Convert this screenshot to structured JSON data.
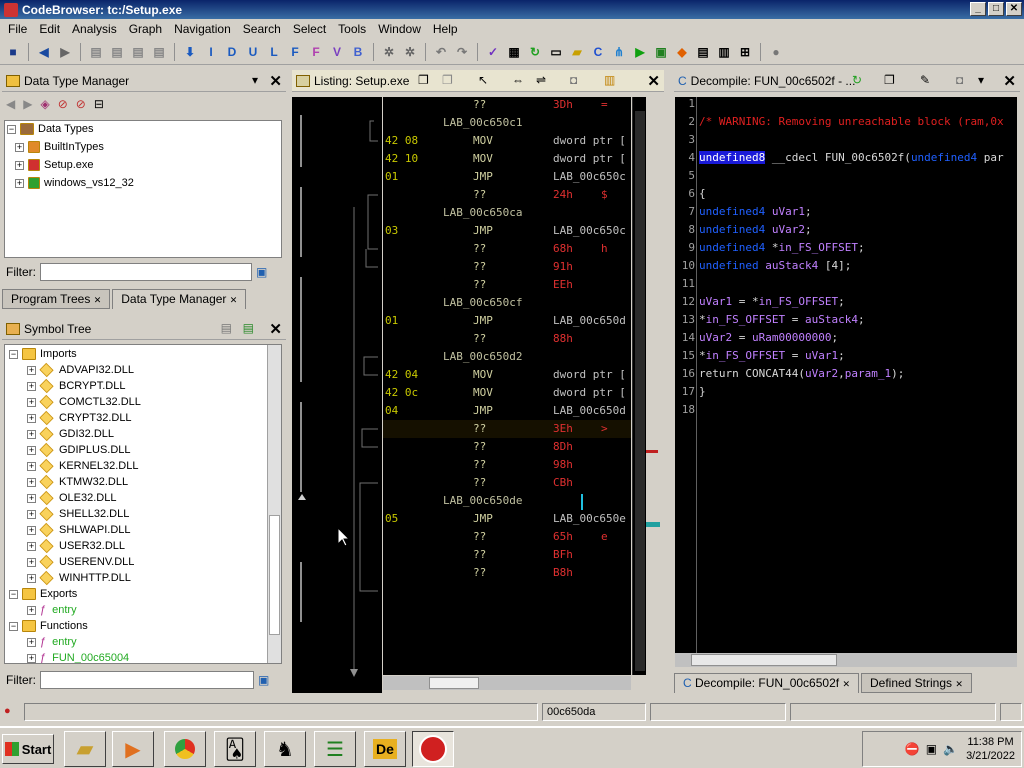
{
  "window": {
    "title": "CodeBrowser: tc:/Setup.exe",
    "min": "_",
    "max": "□",
    "close": "✕"
  },
  "menu": [
    "File",
    "Edit",
    "Analysis",
    "Graph",
    "Navigation",
    "Search",
    "Select",
    "Tools",
    "Window",
    "Help"
  ],
  "toolbar": {
    "icons": [
      "save-icon",
      "back-icon",
      "forward-icon",
      "disassemble-icon",
      "step-icon",
      "I",
      "D",
      "U",
      "L",
      "F",
      "F",
      "V",
      "B"
    ]
  },
  "data_type_manager": {
    "title": "Data Type Manager",
    "root": "Data Types",
    "items": [
      "BuiltInTypes",
      "Setup.exe",
      "windows_vs12_32"
    ],
    "filter_label": "Filter:"
  },
  "left_tabs": [
    "Program Trees",
    "Data Type Manager"
  ],
  "symbol_tree": {
    "title": "Symbol Tree",
    "imports_label": "Imports",
    "imports": [
      "ADVAPI32.DLL",
      "BCRYPT.DLL",
      "COMCTL32.DLL",
      "CRYPT32.DLL",
      "GDI32.DLL",
      "GDIPLUS.DLL",
      "KERNEL32.DLL",
      "KTMW32.DLL",
      "OLE32.DLL",
      "SHELL32.DLL",
      "SHLWAPI.DLL",
      "USER32.DLL",
      "USERENV.DLL",
      "WINHTTP.DLL"
    ],
    "exports_label": "Exports",
    "exports": [
      "entry"
    ],
    "functions_label": "Functions",
    "functions": [
      "entry",
      "FUN_00c65004"
    ],
    "filter_label": "Filter:"
  },
  "listing": {
    "title": "Listing:  Setup.exe",
    "rows": [
      {
        "lab": "",
        "bytes": "",
        "mnem": "??",
        "op": "3Dh",
        "extra": "="
      },
      {
        "lab": "LAB_00c650c1",
        "bytes": "",
        "mnem": "",
        "op": "",
        "extra": ""
      },
      {
        "lab": "",
        "bytes": "42 08",
        "mnem": "MOV",
        "op": "dword ptr [",
        "extra": ""
      },
      {
        "lab": "",
        "bytes": "42 10",
        "mnem": "MOV",
        "op": "dword ptr [",
        "extra": ""
      },
      {
        "lab": "",
        "bytes": "01",
        "mnem": "JMP",
        "op": "LAB_00c650c",
        "extra": ""
      },
      {
        "lab": "",
        "bytes": "",
        "mnem": "??",
        "op": "24h",
        "extra": "$"
      },
      {
        "lab": "LAB_00c650ca",
        "bytes": "",
        "mnem": "",
        "op": "",
        "extra": ""
      },
      {
        "lab": "",
        "bytes": "03",
        "mnem": "JMP",
        "op": "LAB_00c650c",
        "extra": ""
      },
      {
        "lab": "",
        "bytes": "",
        "mnem": "??",
        "op": "68h",
        "extra": "h"
      },
      {
        "lab": "",
        "bytes": "",
        "mnem": "??",
        "op": "91h",
        "extra": ""
      },
      {
        "lab": "",
        "bytes": "",
        "mnem": "??",
        "op": "EEh",
        "extra": ""
      },
      {
        "lab": "LAB_00c650cf",
        "bytes": "",
        "mnem": "",
        "op": "",
        "extra": ""
      },
      {
        "lab": "",
        "bytes": "01",
        "mnem": "JMP",
        "op": "LAB_00c650d",
        "extra": ""
      },
      {
        "lab": "",
        "bytes": "",
        "mnem": "??",
        "op": "88h",
        "extra": ""
      },
      {
        "lab": "LAB_00c650d2",
        "bytes": "",
        "mnem": "",
        "op": "",
        "extra": ""
      },
      {
        "lab": "",
        "bytes": "42 04",
        "mnem": "MOV",
        "op": "dword ptr [",
        "extra": ""
      },
      {
        "lab": "",
        "bytes": "42 0c",
        "mnem": "MOV",
        "op": "dword ptr [",
        "extra": ""
      },
      {
        "lab": "",
        "bytes": "04",
        "mnem": "JMP",
        "op": "LAB_00c650d",
        "extra": ""
      },
      {
        "lab": "",
        "bytes": "",
        "mnem": "??",
        "op": "3Eh",
        "extra": ">"
      },
      {
        "lab": "",
        "bytes": "",
        "mnem": "??",
        "op": "8Dh",
        "extra": ""
      },
      {
        "lab": "",
        "bytes": "",
        "mnem": "??",
        "op": "98h",
        "extra": ""
      },
      {
        "lab": "",
        "bytes": "",
        "mnem": "??",
        "op": "CBh",
        "extra": ""
      },
      {
        "lab": "LAB_00c650de",
        "bytes": "",
        "mnem": "",
        "op": "",
        "extra": ""
      },
      {
        "lab": "",
        "bytes": "05",
        "mnem": "JMP",
        "op": "LAB_00c650e",
        "extra": ""
      },
      {
        "lab": "",
        "bytes": "",
        "mnem": "??",
        "op": "65h",
        "extra": "e"
      },
      {
        "lab": "",
        "bytes": "",
        "mnem": "??",
        "op": "BFh",
        "extra": ""
      },
      {
        "lab": "",
        "bytes": "",
        "mnem": "??",
        "op": "B8h",
        "extra": ""
      }
    ]
  },
  "decompile": {
    "title": "Decompile: FUN_00c6502f - ...",
    "lines": [
      {
        "n": "1",
        "t": ""
      },
      {
        "n": "2",
        "t": "/* WARNING: Removing unreachable block (ram,0x"
      },
      {
        "n": "3",
        "t": ""
      },
      {
        "n": "4",
        "t": "undefined8 __cdecl FUN_00c6502f(undefined4 par"
      },
      {
        "n": "5",
        "t": ""
      },
      {
        "n": "6",
        "t": "{"
      },
      {
        "n": "7",
        "t": "  undefined4 uVar1;"
      },
      {
        "n": "8",
        "t": "  undefined4 uVar2;"
      },
      {
        "n": "9",
        "t": "  undefined4 *in_FS_OFFSET;"
      },
      {
        "n": "10",
        "t": "  undefined auStack4 [4];"
      },
      {
        "n": "11",
        "t": ""
      },
      {
        "n": "12",
        "t": "  uVar1 = *in_FS_OFFSET;"
      },
      {
        "n": "13",
        "t": "  *in_FS_OFFSET = auStack4;"
      },
      {
        "n": "14",
        "t": "  uVar2 = uRam00000000;"
      },
      {
        "n": "15",
        "t": "  *in_FS_OFFSET = uVar1;"
      },
      {
        "n": "16",
        "t": "  return CONCAT44(uVar2,param_1);"
      },
      {
        "n": "17",
        "t": "}"
      },
      {
        "n": "18",
        "t": ""
      }
    ]
  },
  "right_tabs": [
    "Decompile: FUN_00c6502f",
    "Defined Strings"
  ],
  "status": {
    "address": "00c650da"
  },
  "taskbar": {
    "start": "Start",
    "time": "11:38 PM",
    "date": "3/21/2022"
  }
}
